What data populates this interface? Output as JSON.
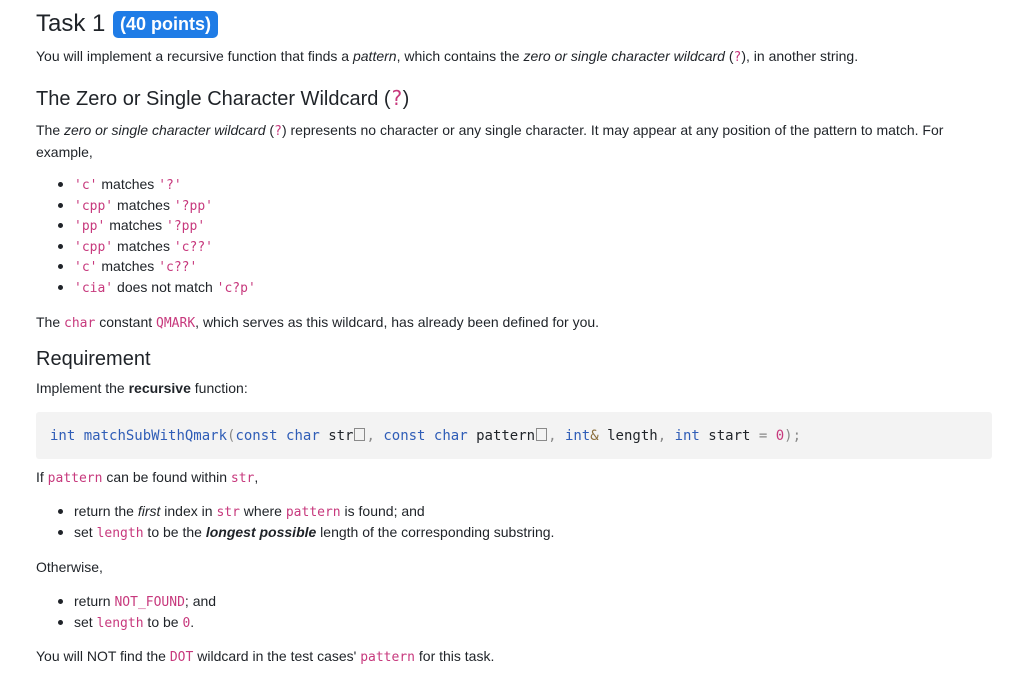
{
  "task": {
    "title": "Task 1",
    "badge": "(40 points)",
    "intro": {
      "t1": "You will implement a recursive function that finds a ",
      "em1": "pattern",
      "t2": ", which contains the ",
      "em2": "zero or single character wildcard",
      "t3": " (",
      "code": "?",
      "t4": "), in another string."
    }
  },
  "section1": {
    "heading": "The Zero or Single Character Wildcard (",
    "heading_code": "?",
    "heading_close": ")",
    "para": {
      "t1": "The ",
      "em": "zero or single character wildcard",
      "t2": " (",
      "code": "?",
      "t3": ") represents no character or any single character. It may appear at any position of the pattern to match. For",
      "t4": "example,"
    },
    "examples": [
      {
        "a": "'c'",
        "verb": " matches ",
        "b": "'?'"
      },
      {
        "a": "'cpp'",
        "verb": " matches ",
        "b": "'?pp'"
      },
      {
        "a": "'pp'",
        "verb": " matches ",
        "b": "'?pp'"
      },
      {
        "a": "'cpp'",
        "verb": " matches ",
        "b": "'c??'"
      },
      {
        "a": "'c'",
        "verb": " matches ",
        "b": "'c??'"
      },
      {
        "a": "'cia'",
        "verb": " does not match ",
        "b": "'c?p'"
      }
    ],
    "note": {
      "t1": "The ",
      "c1": "char",
      "t2": " constant ",
      "c2": "QMARK",
      "t3": ", which serves as this wildcard, has already been defined for you."
    }
  },
  "section2": {
    "heading": "Requirement",
    "implement": {
      "t1": "Implement the ",
      "b": "recursive",
      "t2": " function:"
    },
    "signature": {
      "int1": "int",
      "fname": " matchSubWithQmark",
      "p1": "(",
      "const1": "const",
      "char1": " char",
      "arg1": " str",
      "comma1": ", ",
      "const2": "const",
      "char2": " char",
      "arg2": " pattern",
      "comma2": ", ",
      "int2": "int",
      "amp": "&",
      "arg3": " length",
      "comma3": ", ",
      "int3": "int",
      "arg4": " start ",
      "eq": "=",
      "zero": " 0",
      "close": ");"
    },
    "if_line": {
      "t1": "If ",
      "c1": "pattern",
      "t2": " can be found within ",
      "c2": "str",
      "t3": ","
    },
    "found_list": [
      {
        "t1": "return the ",
        "em": "first",
        "t2": " index in ",
        "c1": "str",
        "t3": " where ",
        "c2": "pattern",
        "t4": " is found; and"
      },
      {
        "t1": "set ",
        "c1": "length",
        "t2": " to be the ",
        "bem": "longest possible",
        "t3": " length of the corresponding substring."
      }
    ],
    "otherwise": "Otherwise,",
    "notfound_list": [
      {
        "t1": "return ",
        "c1": "NOT_FOUND",
        "t2": "; and"
      },
      {
        "t1": "set ",
        "c1": "length",
        "t2": " to be ",
        "c2": "0",
        "t3": "."
      }
    ],
    "final": {
      "t1": "You will NOT find the ",
      "c1": "DOT",
      "t2": " wildcard in the test cases' ",
      "c2": "pattern",
      "t3": " for this task."
    }
  }
}
